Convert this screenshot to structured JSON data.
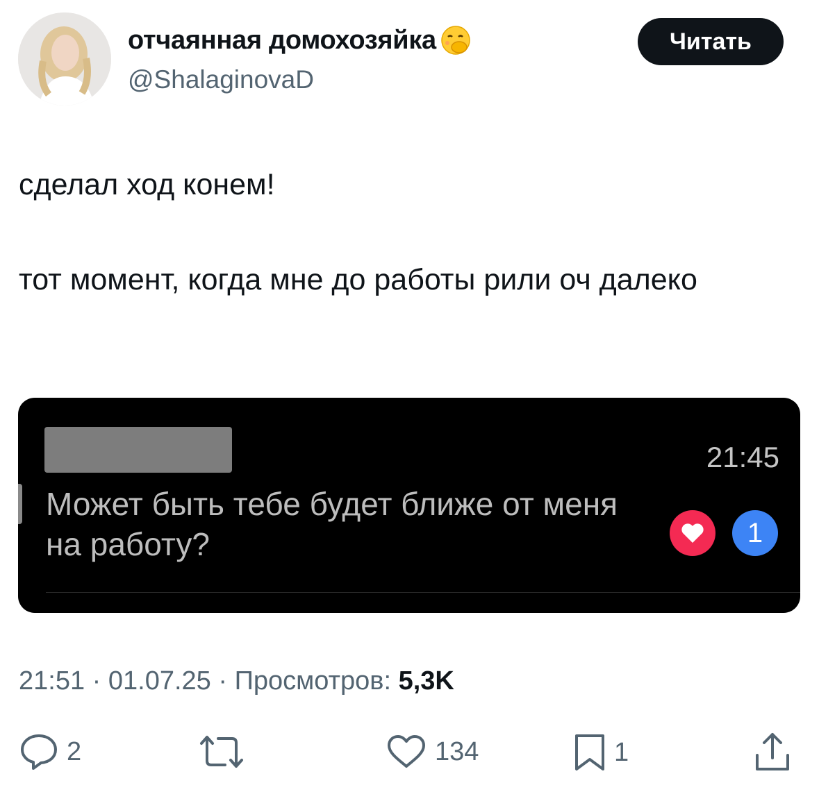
{
  "author": {
    "display_name": "отчаянная домохозяйка",
    "handle": "@ShalaginovaD",
    "emoji_icon": "face-with-hand-over-mouth-emoji"
  },
  "follow_button": {
    "label": "Читать"
  },
  "tweet": {
    "line1": "сделал ход конем!",
    "line2": "тот момент, когда мне до работы рили оч далеко"
  },
  "media": {
    "message_time": "21:45",
    "message_text": "Может быть тебе будет ближе от меня на работу?",
    "reaction_count": "1",
    "colors": {
      "heart_bg": "#f42a53",
      "count_bg": "#3d84f5"
    }
  },
  "meta": {
    "time": "21:51",
    "date": "01.07.25",
    "views_label": "Просмотров:",
    "views_value": "5,3K"
  },
  "actions": {
    "replies": "2",
    "retweets": "",
    "likes": "134",
    "bookmarks": "1"
  }
}
